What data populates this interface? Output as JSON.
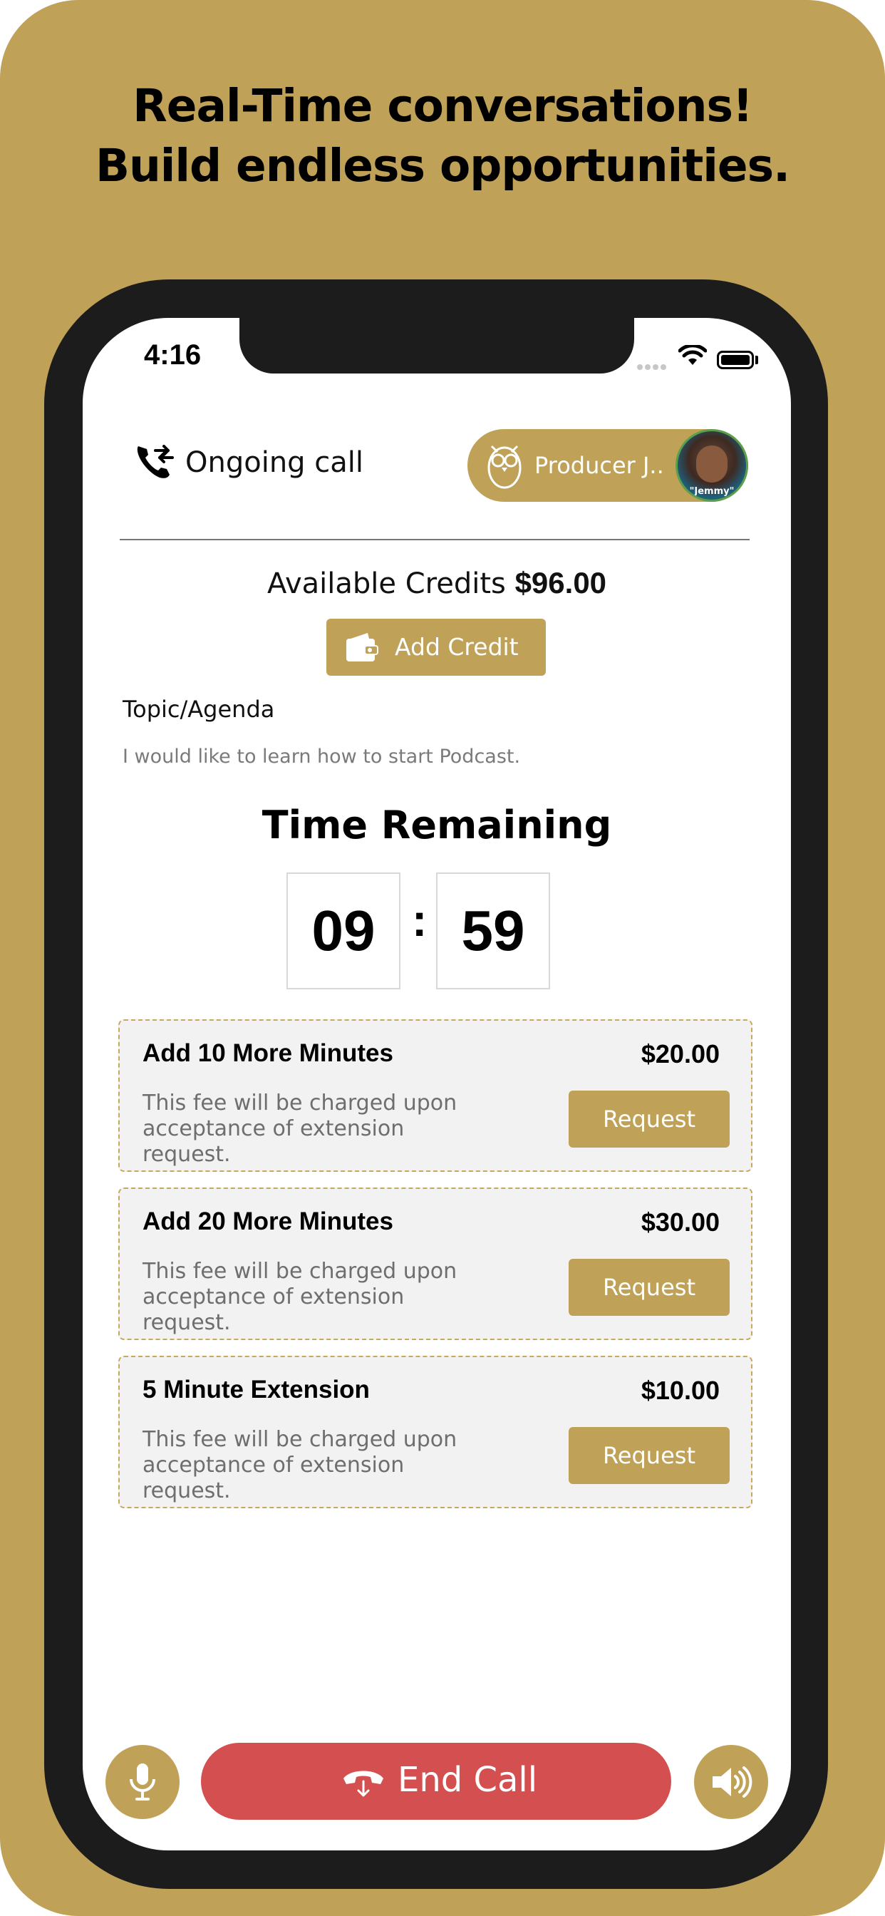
{
  "marketing": {
    "headline_line1": "Real-Time conversations!",
    "headline_line2": "Build endless opportunities."
  },
  "status_bar": {
    "time": "4:16"
  },
  "header": {
    "call_status": "Ongoing call",
    "producer_name": "Producer J..",
    "avatar_caption": "\"Jemmy\""
  },
  "credits": {
    "label": "Available Credits",
    "amount": "$96.00",
    "add_credit_label": "Add Credit"
  },
  "topic": {
    "title": "Topic/Agenda",
    "text": "I would like to learn how to start Podcast."
  },
  "timer": {
    "title": "Time Remaining",
    "minutes": "09",
    "separator": ":",
    "seconds": "59"
  },
  "extensions": [
    {
      "title": "Add 10 More Minutes",
      "price": "$20.00",
      "description": "This fee will be charged upon acceptance of extension request.",
      "button_label": "Request"
    },
    {
      "title": "Add 20 More Minutes",
      "price": "$30.00",
      "description": "This fee will be charged upon acceptance of extension request.",
      "button_label": "Request"
    },
    {
      "title": "5 Minute Extension",
      "price": "$10.00",
      "description": "This fee will be charged upon acceptance of extension request.",
      "button_label": "Request"
    }
  ],
  "controls": {
    "end_call_label": "End Call",
    "mic_icon": "microphone-icon",
    "speaker_icon": "speaker-icon"
  },
  "colors": {
    "brand_gold": "#c0a158",
    "end_call_red": "#d45050",
    "phone_frame": "#1c1c1c"
  }
}
